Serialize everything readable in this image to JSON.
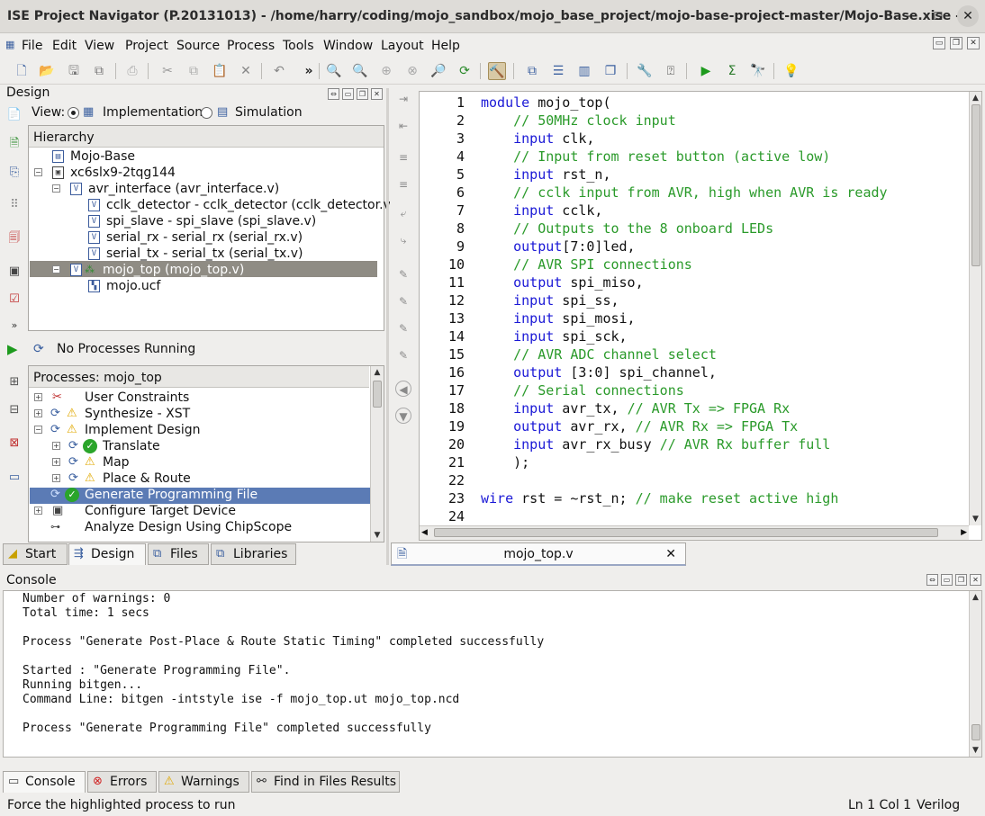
{
  "window": {
    "title": "ISE Project Navigator (P.20131013) - /home/harry/coding/mojo_sandbox/mojo_base_project/mojo-base-project-master/Mojo-Base.xise -..."
  },
  "menu": [
    "File",
    "Edit",
    "View",
    "Project",
    "Source",
    "Process",
    "Tools",
    "Window",
    "Layout",
    "Help"
  ],
  "design_panel": {
    "title": "Design",
    "view_label": "View:",
    "view_implementation": "Implementation",
    "view_simulation": "Simulation",
    "hierarchy_header": "Hierarchy",
    "hierarchy": [
      {
        "label": "Mojo-Base",
        "icon": "project-icon"
      },
      {
        "label": "xc6slx9-2tqg144",
        "icon": "chip-icon"
      },
      {
        "label": "avr_interface (avr_interface.v)",
        "icon": "verilog-file-icon"
      },
      {
        "label": "cclk_detector - cclk_detector (cclk_detector.v)",
        "icon": "verilog-file-icon"
      },
      {
        "label": "spi_slave - spi_slave (spi_slave.v)",
        "icon": "verilog-file-icon"
      },
      {
        "label": "serial_rx - serial_rx (serial_rx.v)",
        "icon": "verilog-file-icon"
      },
      {
        "label": "serial_tx - serial_tx (serial_tx.v)",
        "icon": "verilog-file-icon"
      },
      {
        "label": "mojo_top (mojo_top.v)",
        "icon": "verilog-top-icon",
        "selected": true
      },
      {
        "label": "mojo.ucf",
        "icon": "constraints-file-icon"
      }
    ],
    "process_status": "No Processes Running",
    "processes_header": "Processes: mojo_top",
    "processes": [
      {
        "label": "User Constraints",
        "status": ""
      },
      {
        "label": "Synthesize - XST",
        "status": "warning"
      },
      {
        "label": "Implement Design",
        "status": "warning"
      },
      {
        "label": "Translate",
        "status": "ok"
      },
      {
        "label": "Map",
        "status": "warning"
      },
      {
        "label": "Place & Route",
        "status": "warning"
      },
      {
        "label": "Generate Programming File",
        "status": "ok",
        "selected": true
      },
      {
        "label": "Configure Target Device",
        "status": ""
      },
      {
        "label": "Analyze Design Using ChipScope",
        "status": ""
      }
    ],
    "tabs": [
      "Start",
      "Design",
      "Files",
      "Libraries"
    ]
  },
  "editor": {
    "tab_label": "mojo_top.v",
    "lines": [
      [
        {
          "t": "module mojo_top(",
          "c": "kw-first"
        }
      ],
      [
        {
          "t": "    // 50MHz clock input",
          "c": "cm"
        }
      ],
      [
        {
          "t": "    ",
          "c": "tx"
        },
        {
          "t": "input",
          "c": "kw"
        },
        {
          "t": " clk,",
          "c": "tx"
        }
      ],
      [
        {
          "t": "    // Input from reset button (active low)",
          "c": "cm"
        }
      ],
      [
        {
          "t": "    ",
          "c": "tx"
        },
        {
          "t": "input",
          "c": "kw"
        },
        {
          "t": " rst_n,",
          "c": "tx"
        }
      ],
      [
        {
          "t": "    // cclk input from AVR, high when AVR is ready",
          "c": "cm"
        }
      ],
      [
        {
          "t": "    ",
          "c": "tx"
        },
        {
          "t": "input",
          "c": "kw"
        },
        {
          "t": " cclk,",
          "c": "tx"
        }
      ],
      [
        {
          "t": "    // Outputs to the 8 onboard LEDs",
          "c": "cm"
        }
      ],
      [
        {
          "t": "    ",
          "c": "tx"
        },
        {
          "t": "output",
          "c": "kw"
        },
        {
          "t": "[7:0]led,",
          "c": "tx"
        }
      ],
      [
        {
          "t": "    // AVR SPI connections",
          "c": "cm"
        }
      ],
      [
        {
          "t": "    ",
          "c": "tx"
        },
        {
          "t": "output",
          "c": "kw"
        },
        {
          "t": " spi_miso,",
          "c": "tx"
        }
      ],
      [
        {
          "t": "    ",
          "c": "tx"
        },
        {
          "t": "input",
          "c": "kw"
        },
        {
          "t": " spi_ss,",
          "c": "tx"
        }
      ],
      [
        {
          "t": "    ",
          "c": "tx"
        },
        {
          "t": "input",
          "c": "kw"
        },
        {
          "t": " spi_mosi,",
          "c": "tx"
        }
      ],
      [
        {
          "t": "    ",
          "c": "tx"
        },
        {
          "t": "input",
          "c": "kw"
        },
        {
          "t": " spi_sck,",
          "c": "tx"
        }
      ],
      [
        {
          "t": "    // AVR ADC channel select",
          "c": "cm"
        }
      ],
      [
        {
          "t": "    ",
          "c": "tx"
        },
        {
          "t": "output",
          "c": "kw"
        },
        {
          "t": " [3:0] spi_channel,",
          "c": "tx"
        }
      ],
      [
        {
          "t": "    // Serial connections",
          "c": "cm"
        }
      ],
      [
        {
          "t": "    ",
          "c": "tx"
        },
        {
          "t": "input",
          "c": "kw"
        },
        {
          "t": " avr_tx, ",
          "c": "tx"
        },
        {
          "t": "// AVR Tx => FPGA Rx",
          "c": "cm"
        }
      ],
      [
        {
          "t": "    ",
          "c": "tx"
        },
        {
          "t": "output",
          "c": "kw"
        },
        {
          "t": " avr_rx, ",
          "c": "tx"
        },
        {
          "t": "// AVR Rx => FPGA Tx",
          "c": "cm"
        }
      ],
      [
        {
          "t": "    ",
          "c": "tx"
        },
        {
          "t": "input",
          "c": "kw"
        },
        {
          "t": " avr_rx_busy ",
          "c": "tx"
        },
        {
          "t": "// AVR Rx buffer full",
          "c": "cm"
        }
      ],
      [
        {
          "t": "    );",
          "c": "tx"
        }
      ],
      [
        {
          "t": "",
          "c": "tx"
        }
      ],
      [
        {
          "t": "wire",
          "c": "kw"
        },
        {
          "t": " rst = ~rst_n; ",
          "c": "tx"
        },
        {
          "t": "// make reset active high",
          "c": "cm"
        }
      ],
      [
        {
          "t": "",
          "c": "tx"
        }
      ]
    ]
  },
  "console": {
    "title": "Console",
    "lines": [
      "Number of warnings: 0",
      "Total time: 1 secs",
      "",
      "Process \"Generate Post-Place & Route Static Timing\" completed successfully",
      "",
      "Started : \"Generate Programming File\".",
      "Running bitgen...",
      "Command Line: bitgen -intstyle ise -f mojo_top.ut mojo_top.ncd",
      "",
      "Process \"Generate Programming File\" completed successfully"
    ],
    "tabs": [
      "Console",
      "Errors",
      "Warnings",
      "Find in Files Results"
    ]
  },
  "status": {
    "message": "Force the highlighted process to run",
    "position": "Ln 1 Col 1",
    "language": "Verilog"
  },
  "colors": {
    "keyword": "#1a18d6",
    "comment": "#2a9a2a",
    "selection": "#5b7bb5",
    "hier_selection": "#8f8c84"
  }
}
